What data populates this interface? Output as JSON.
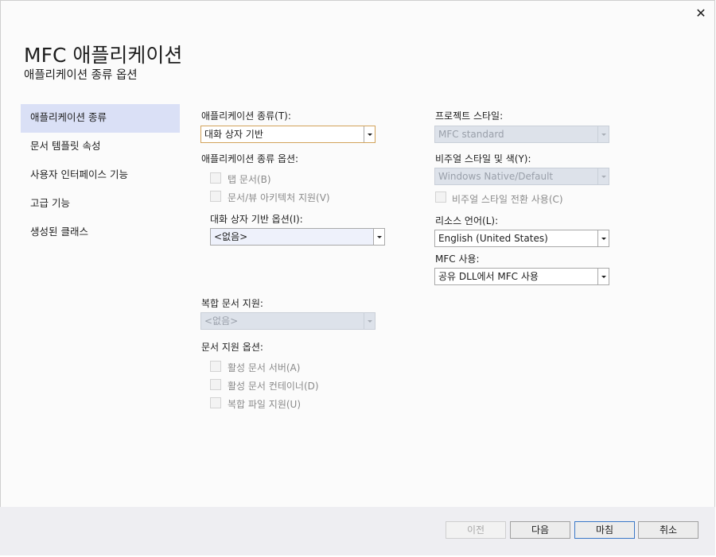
{
  "header": {
    "title": "MFC 애플리케이션",
    "subtitle": "애플리케이션 종류 옵션",
    "close_glyph": "✕"
  },
  "sidebar": {
    "items": [
      {
        "label": "애플리케이션 종류",
        "selected": true
      },
      {
        "label": "문서 템플릿 속성",
        "selected": false
      },
      {
        "label": "사용자 인터페이스 기능",
        "selected": false
      },
      {
        "label": "고급 기능",
        "selected": false
      },
      {
        "label": "생성된 클래스",
        "selected": false
      }
    ]
  },
  "left": {
    "app_type_label": "애플리케이션 종류(T):",
    "app_type_value": "대화 상자 기반",
    "app_type_options_label": "애플리케이션 종류 옵션:",
    "tabbed_docs": "탭 문서(B)",
    "doc_view_arch": "문서/뷰 아키텍처 지원(V)",
    "dialog_options_label": "대화 상자 기반 옵션(I):",
    "dialog_options_value": "<없음>",
    "compound_doc_label": "복합 문서 지원:",
    "compound_doc_value": "<없음>",
    "doc_support_options_label": "문서 지원 옵션:",
    "active_doc_server": "활성 문서 서버(A)",
    "active_doc_container": "활성 문서 컨테이너(D)",
    "compound_file_support": "복합 파일 지원(U)"
  },
  "right": {
    "project_style_label": "프로젝트 스타일:",
    "project_style_value": "MFC standard",
    "visual_style_label": "비주얼 스타일 및 색(Y):",
    "visual_style_value": "Windows Native/Default",
    "visual_style_switch": "비주얼 스타일 전환 사용(C)",
    "resource_lang_label": "리소스 언어(L):",
    "resource_lang_value": "English (United States)",
    "mfc_use_label": "MFC 사용:",
    "mfc_use_value": "공유 DLL에서 MFC 사용"
  },
  "footer": {
    "prev": "이전",
    "next": "다음",
    "finish": "마침",
    "cancel": "취소"
  }
}
